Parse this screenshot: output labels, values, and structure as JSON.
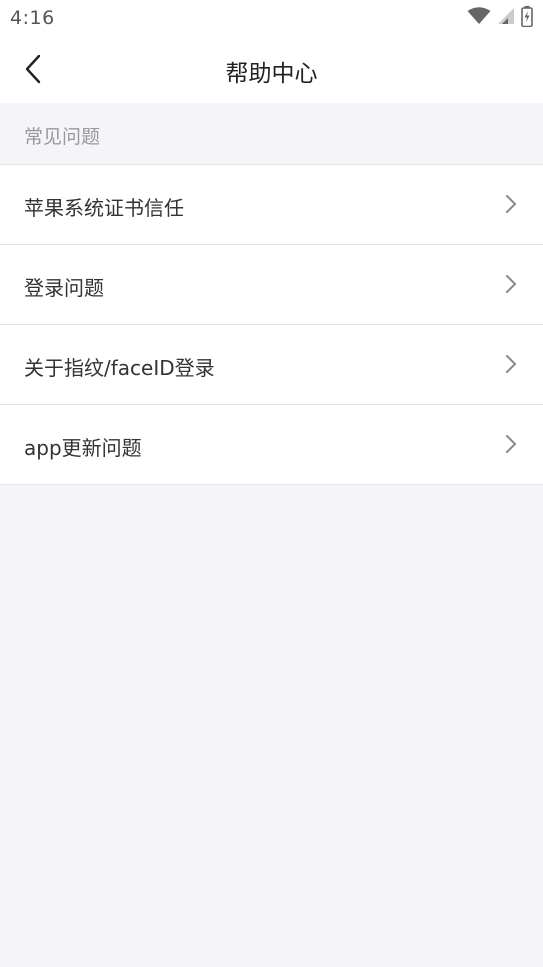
{
  "status_bar": {
    "time": "4:16",
    "icons": [
      "wifi-icon",
      "signal-icon",
      "battery-charging-icon"
    ]
  },
  "nav": {
    "back_icon": "chevron-left-icon",
    "title": "帮助中心"
  },
  "section": {
    "title": "常见问题"
  },
  "faq": {
    "items": [
      {
        "label": "苹果系统证书信任",
        "icon": "chevron-right-icon"
      },
      {
        "label": "登录问题",
        "icon": "chevron-right-icon"
      },
      {
        "label": "关于指纹/faceID登录",
        "icon": "chevron-right-icon"
      },
      {
        "label": "app更新问题",
        "icon": "chevron-right-icon"
      }
    ]
  },
  "colors": {
    "background": "#f5f5f9",
    "surface": "#ffffff",
    "divider": "#e4e4e4",
    "text_primary": "#333333",
    "text_secondary": "#999999"
  }
}
